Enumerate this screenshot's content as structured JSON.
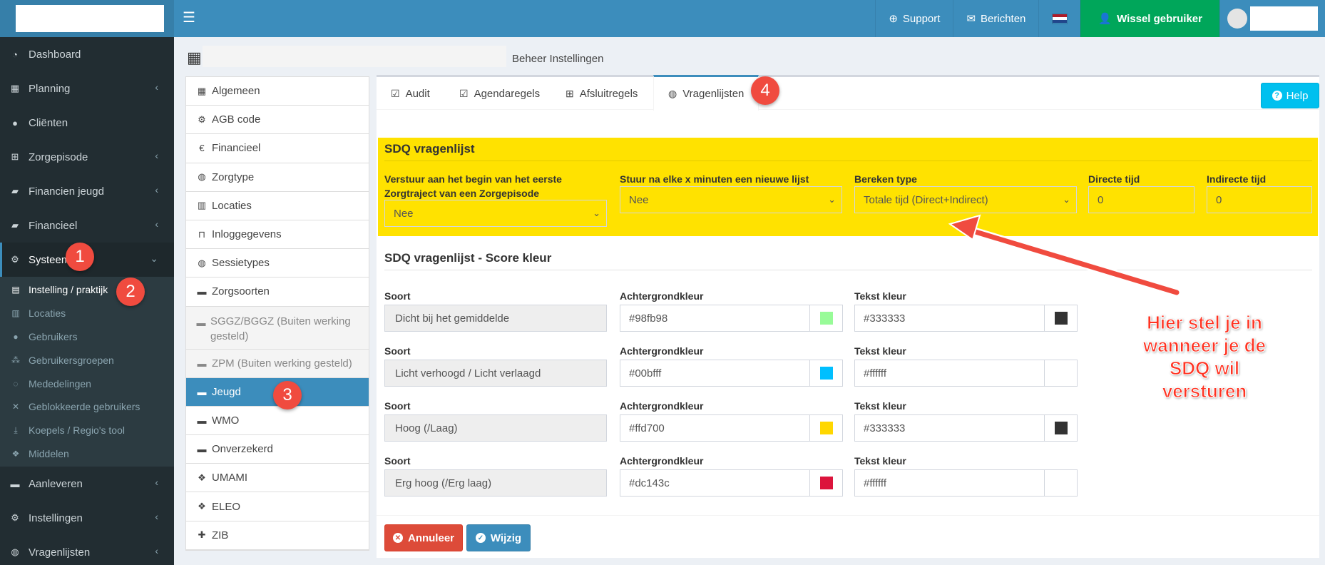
{
  "topbar": {
    "support": "Support",
    "berichten": "Berichten",
    "wissel": "Wissel gebruiker",
    "flag_colors": [
      "#ae1c28",
      "#ffffff",
      "#21468b"
    ],
    "icons": [
      "menu-icon",
      "lifering-icon",
      "envelope-icon",
      "flag-nl-icon",
      "user-secret-icon"
    ]
  },
  "sidebar": {
    "items": [
      {
        "label": "Dashboard",
        "icon": "dashboard-icon"
      },
      {
        "label": "Planning",
        "icon": "calendar-icon"
      },
      {
        "label": "Cliënten",
        "icon": "user-icon"
      },
      {
        "label": "Zorgepisode",
        "icon": "medkit-icon"
      },
      {
        "label": "Financien jeugd",
        "icon": "book-icon"
      },
      {
        "label": "Financieel",
        "icon": "book-icon"
      },
      {
        "label": "Systeem",
        "icon": "cogs-icon"
      }
    ],
    "submenu": [
      "Instelling / praktijk",
      "Locaties",
      "Gebruikers",
      "Gebruikersgroepen",
      "Mededelingen",
      "Geblokkeerde gebruikers",
      "Koepels / Regio's tool",
      "Middelen"
    ],
    "bottom": [
      {
        "label": "Aanleveren",
        "icon": "truck-icon"
      },
      {
        "label": "Instellingen",
        "icon": "cog-icon"
      },
      {
        "label": "Vragenlijsten",
        "icon": "globe-icon"
      }
    ]
  },
  "header": {
    "title": "Beheer Instellingen"
  },
  "settings_list": [
    "Algemeen",
    "AGB code",
    "Financieel",
    "Zorgtype",
    "Locaties",
    "Inloggegevens",
    "Sessietypes",
    "Zorgsoorten",
    "SGGZ/BGGZ (Buiten werking gesteld)",
    "ZPM (Buiten werking gesteld)",
    "Jeugd",
    "WMO",
    "Onverzekerd",
    "UMAMI",
    "ELEO",
    "ZIB"
  ],
  "tabs": [
    "Audit",
    "Agendaregels",
    "Afsluitregels",
    "Vragenlijsten"
  ],
  "help": "Help",
  "sdq": {
    "title": "SDQ vragenlijst",
    "col1_label": "Verstuur aan het begin van het eerste Zorgtraject van een Zorgepisode",
    "col1_value": "Nee",
    "col2_label": "Stuur na elke x minuten een nieuwe lijst",
    "col2_value": "Nee",
    "col3_label": "Bereken type",
    "col3_value": "Totale tijd (Direct+Indirect)",
    "col4_label": "Directe tijd",
    "col4_value": "0",
    "col5_label": "Indirecte tijd",
    "col5_value": "0",
    "highlight_color": "#ffe200"
  },
  "score": {
    "title": "SDQ vragenlijst - Score kleur",
    "soort_label": "Soort",
    "achtergrond_label": "Achtergrondkleur",
    "tekst_label": "Tekst kleur",
    "rows": [
      {
        "soort": "Dicht bij het gemiddelde",
        "bg": "#98fb98",
        "text": "#333333"
      },
      {
        "soort": "Licht verhoogd / Licht verlaagd",
        "bg": "#00bfff",
        "text": "#ffffff"
      },
      {
        "soort": "Hoog (/Laag)",
        "bg": "#ffd700",
        "text": "#333333"
      },
      {
        "soort": "Erg hoog (/Erg laag)",
        "bg": "#dc143c",
        "text": "#ffffff"
      }
    ]
  },
  "footer": {
    "annuleer": "Annuleer",
    "wijzig": "Wijzig"
  },
  "annotations": {
    "badges": [
      "1",
      "2",
      "3",
      "4"
    ],
    "callout_lines": [
      "Hier stel je in",
      "wanneer je de",
      "SDQ wil",
      "versturen"
    ]
  }
}
